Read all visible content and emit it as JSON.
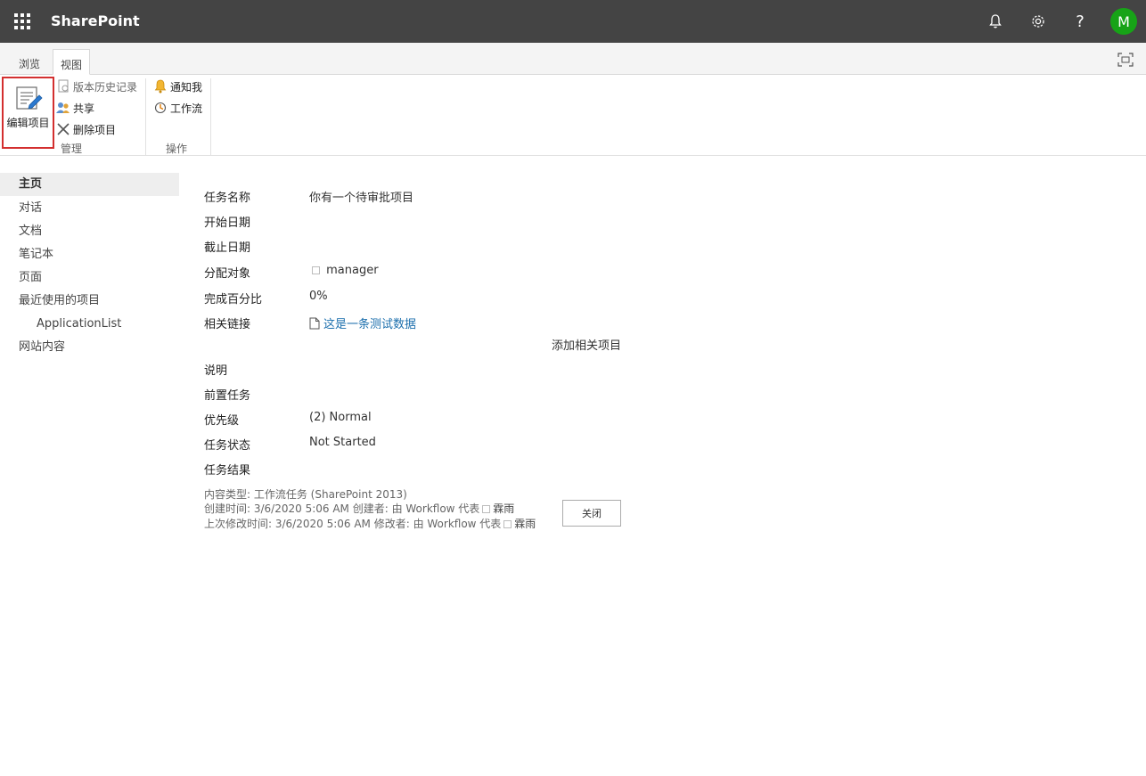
{
  "suite_bar": {
    "brand": "SharePoint",
    "icons": [
      "app-launcher-icon",
      "bell-icon",
      "gear-icon",
      "help-icon"
    ],
    "avatar_initial": "M",
    "avatar_color": "#17a317",
    "bar_color": "#444444"
  },
  "ribbon": {
    "tabs": [
      {
        "label": "浏览",
        "active": false
      },
      {
        "label": "视图",
        "active": true
      }
    ],
    "edit_item_label": "编辑项目",
    "manage": {
      "version_history": "版本历史记录",
      "share": "共享",
      "delete_item": "删除项目",
      "group_label": "管理"
    },
    "actions": {
      "alert_me": "通知我",
      "workflows": "工作流",
      "group_label": "操作"
    }
  },
  "nav": {
    "items": [
      {
        "label": "主页",
        "selected": true
      },
      {
        "label": "对话"
      },
      {
        "label": "文档"
      },
      {
        "label": "笔记本"
      },
      {
        "label": "页面"
      },
      {
        "label": "最近使用的项目"
      },
      {
        "label": "ApplicationList",
        "indent": true
      },
      {
        "label": "网站内容"
      }
    ]
  },
  "form": {
    "fields": [
      {
        "label": "任务名称",
        "value": "你有一个待审批项目"
      },
      {
        "label": "开始日期",
        "value": ""
      },
      {
        "label": "截止日期",
        "value": ""
      },
      {
        "label": "分配对象",
        "value": "manager"
      },
      {
        "label": "完成百分比",
        "value": "0%"
      },
      {
        "label": "相关链接",
        "value": "这是一条测试数据"
      },
      {
        "label": "说明",
        "value": ""
      },
      {
        "label": "前置任务",
        "value": ""
      },
      {
        "label": "优先级",
        "value": "(2) Normal"
      },
      {
        "label": "任务状态",
        "value": "Not Started"
      },
      {
        "label": "任务结果",
        "value": ""
      }
    ],
    "add_related": "添加相关项目"
  },
  "meta": {
    "content_type": "内容类型: 工作流任务 (SharePoint 2013)",
    "created_prefix": "创建时间: 3/6/2020 5:06 AM  创建者: 由 Workflow 代表",
    "created_user": "霖雨",
    "modified_prefix": "上次修改时间: 3/6/2020 5:06 AM  修改者: 由 Workflow 代表",
    "modified_user": "霖雨"
  },
  "close_label": "关闭",
  "accent": {
    "highlight_border": "#d32f2f",
    "link": "#1c6fad"
  }
}
